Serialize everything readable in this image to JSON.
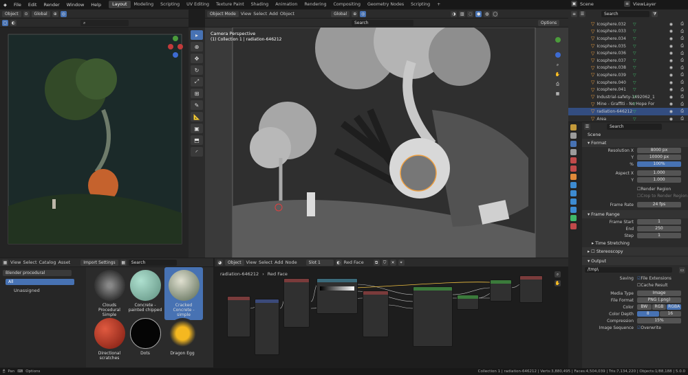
{
  "topmenu": {
    "file": "File",
    "edit": "Edit",
    "render": "Render",
    "window": "Window",
    "help": "Help"
  },
  "workspaces": [
    "Layout",
    "Modeling",
    "Scripting",
    "UV Editing",
    "Texture Paint",
    "Shading",
    "Animation",
    "Rendering",
    "Compositing",
    "Geometry Nodes",
    "Scripting"
  ],
  "scene": "Scene",
  "view_layer": "ViewLayer",
  "camview": {
    "object_mode": "Object",
    "orientation": "Global"
  },
  "viewport": {
    "mode": "Object Mode",
    "view": "View",
    "select": "Select",
    "add": "Add",
    "object": "Object",
    "orientation": "Global",
    "options": "Options",
    "title": "Camera Perspective",
    "subtitle": "(1) Collection 1 | radiation-646212",
    "search_placeholder": "Search"
  },
  "outliner": {
    "search_placeholder": "Search",
    "rows": [
      "Icosphere.032",
      "Icosphere.033",
      "Icosphere.034",
      "Icosphere.035",
      "Icosphere.036",
      "Icosphere.037",
      "Icosphere.038",
      "Icosphere.039",
      "Icosphere.040",
      "Icosphere.041",
      "Industrial-safety-1492062_1",
      "Mine - Graffiti - No Hope For",
      "radiation-646212",
      "Area"
    ]
  },
  "properties": {
    "search_placeholder": "Search",
    "scene": "Scene",
    "format": "Format",
    "res_x_label": "Resolution X",
    "res_x": "8000 px",
    "y_label": "Y",
    "res_y": "10000 px",
    "pct_label": "%",
    "pct": "100%",
    "aspect_x_label": "Aspect X",
    "aspect_x": "1.000",
    "aspect_y": "1.000",
    "render_region": "Render Region",
    "crop": "Crop to Render Region",
    "frame_rate_label": "Frame Rate",
    "frame_rate": "24 fps",
    "frame_range": "Frame Range",
    "frame_start_label": "Frame Start",
    "frame_start": "1",
    "end_label": "End",
    "end": "250",
    "step_label": "Step",
    "step": "1",
    "time_stretching": "Time Stretching",
    "stereoscopy": "Stereoscopy",
    "output": "Output",
    "path": "/tmp\\",
    "saving_label": "Saving",
    "file_ext": "File Extensions",
    "cache_result": "Cache Result",
    "media_type_label": "Media Type",
    "media_type": "Image",
    "file_format_label": "File Format",
    "file_format": "PNG (.png)",
    "color_label": "Color",
    "bw": "BW",
    "rgb": "RGB",
    "rgba": "RGBA",
    "depth_label": "Color Depth",
    "d8": "8",
    "d16": "16",
    "compression_label": "Compression",
    "compression": "15%",
    "img_seq_label": "Image Sequence",
    "overwrite": "Overwrite"
  },
  "assets": {
    "view": "View",
    "select": "Select",
    "catalog": "Catalog",
    "asset": "Asset",
    "import_settings": "Import Settings",
    "library": "Blender procedural",
    "all": "All",
    "unassigned": "Unassigned",
    "items": [
      "Clouds Procedural Simple",
      "Concrete - painted chipped",
      "Cracked Concrete - simple",
      "Directional scratches",
      "Dots",
      "Dragon Egg"
    ],
    "search_placeholder": "Search"
  },
  "nodes": {
    "object": "Object",
    "view": "View",
    "select": "Select",
    "add": "Add",
    "node": "Node",
    "slot": "Slot 1",
    "material": "Red Face",
    "breadcrumb1": "radiation-646212",
    "breadcrumb2": "Red Face"
  },
  "status": {
    "pan": "Pan",
    "options": "Options",
    "info": "Collection 1 | radiation-646212 | Verts:3,880,495 | Faces:4,504,039 | Tris:7,134,220 | Objects:1/88,188 | 5.0.0"
  }
}
